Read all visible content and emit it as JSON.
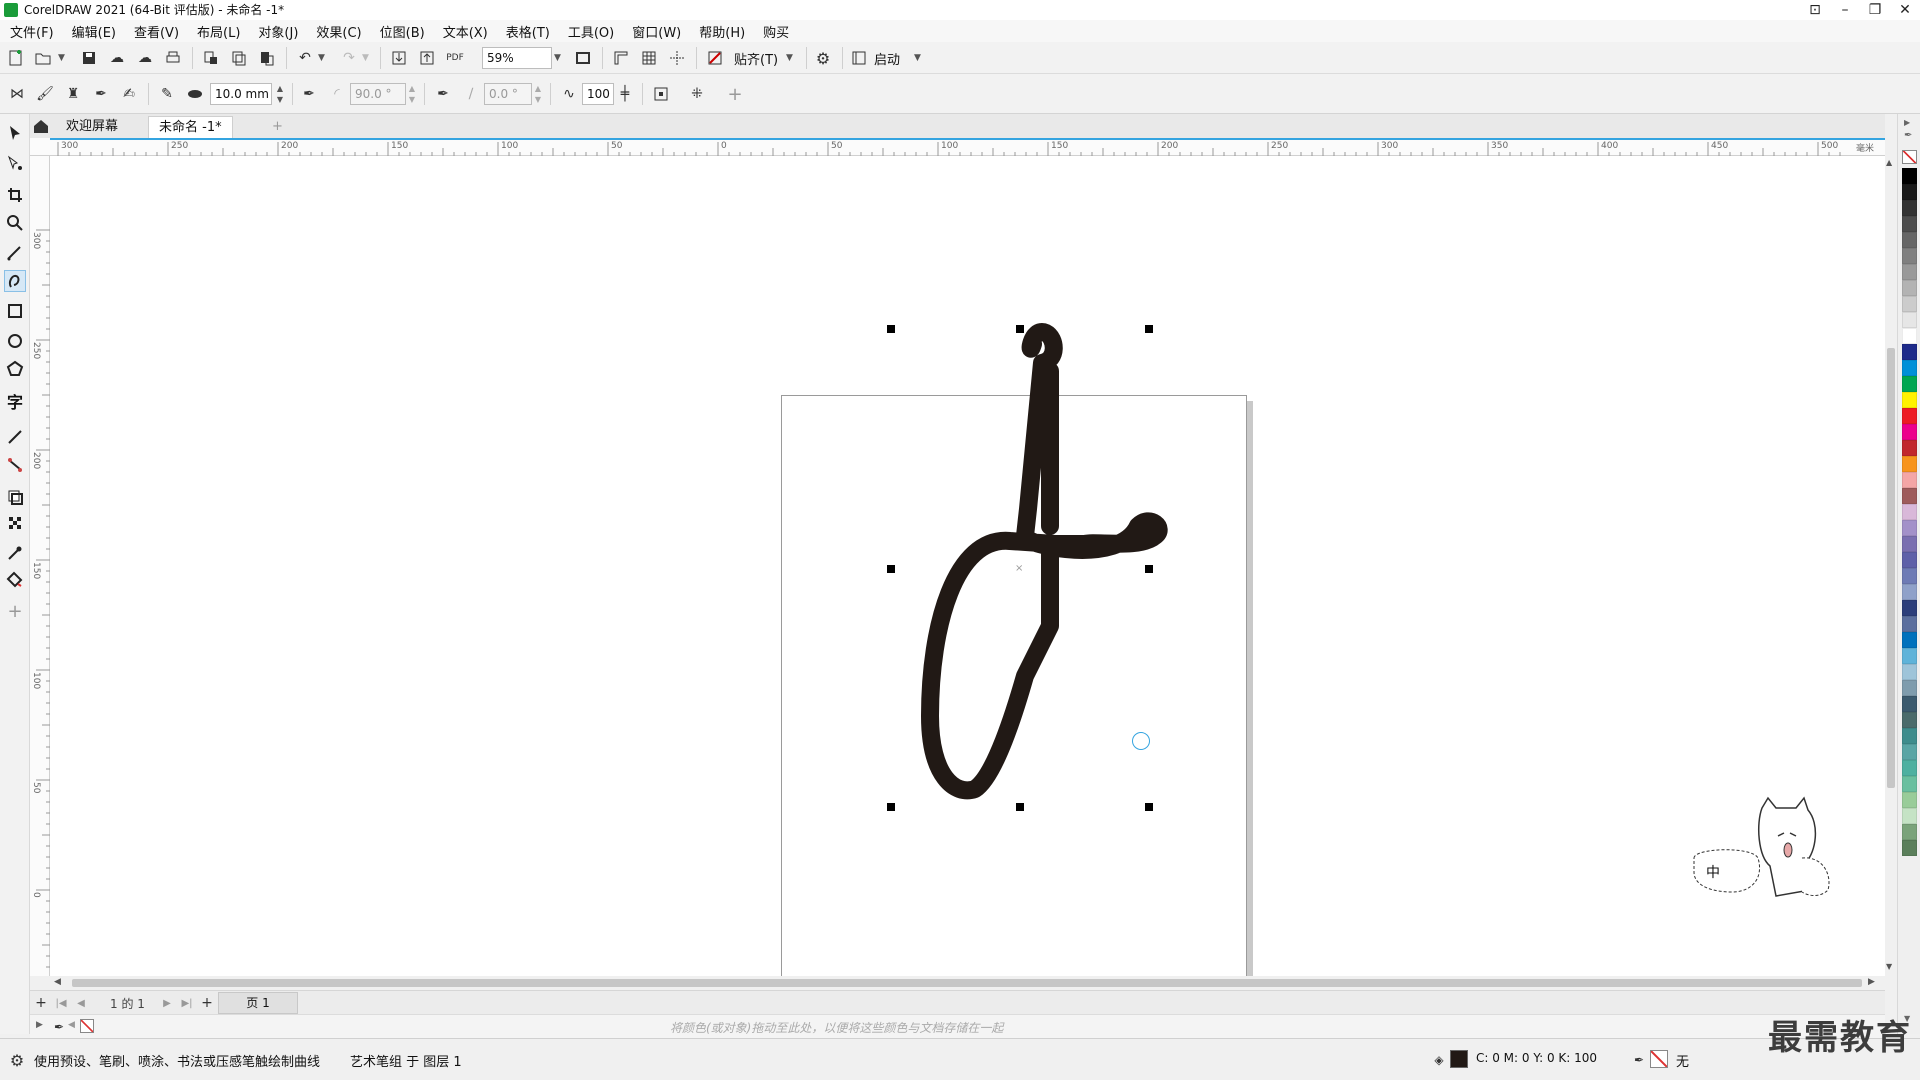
{
  "window": {
    "title": "CorelDRAW 2021 (64-Bit 评估版) - 未命名 -1*",
    "controls": [
      "minimize",
      "restore",
      "close"
    ]
  },
  "menu": [
    "文件(F)",
    "编辑(E)",
    "查看(V)",
    "布局(L)",
    "对象(J)",
    "效果(C)",
    "位图(B)",
    "文本(X)",
    "表格(T)",
    "工具(O)",
    "窗口(W)",
    "帮助(H)",
    "购买"
  ],
  "standard_toolbar": {
    "zoom_value": "59%",
    "snap_label": "贴齐(T)",
    "launch_label": "启动"
  },
  "property_bar": {
    "stroke_width": "10.0 mm",
    "angle1": "90.0 °",
    "angle2": "0.0 °",
    "smoothing": "100"
  },
  "doc_tabs": {
    "welcome": "欢迎屏幕",
    "active": "未命名 -1*",
    "add": "+"
  },
  "ruler": {
    "units": "毫米",
    "h_ticks": [
      "300",
      "250",
      "200",
      "150",
      "100",
      "50",
      "0",
      "50",
      "100",
      "150",
      "200",
      "250",
      "300",
      "350",
      "400",
      "450",
      "500"
    ],
    "v_ticks": [
      "300",
      "250",
      "200",
      "150",
      "100",
      "50",
      "0"
    ]
  },
  "page_nav": {
    "page_count": "1 的 1",
    "page_tab": "页 1"
  },
  "color_docker_hint": "将颜色(或对象)拖动至此处，以便将这些颜色与文档存储在一起",
  "status": {
    "tool_hint": "使用预设、笔刷、喷涂、书法或压感笔触绘制曲线",
    "selection": "艺术笔组 于 图层 1",
    "fill_cmyk": "C: 0 M: 0 Y: 0 K: 100",
    "outline": "无"
  },
  "ime_widget": {
    "label": "中"
  },
  "watermark": "最需教育",
  "colors": {
    "accent": "#34a4e0",
    "stroke": "#211915",
    "palette": [
      "#000000",
      "#1a1a1a",
      "#333333",
      "#4d4d4d",
      "#666666",
      "#808080",
      "#999999",
      "#b3b3b3",
      "#cccccc",
      "#e6e6e6",
      "#ffffff",
      "#1e2b8a",
      "#0090d8",
      "#00a651",
      "#fff200",
      "#ed1c24",
      "#ec008c",
      "#c1272d",
      "#f7941d",
      "#f4a6a6",
      "#9e5b5b",
      "#d9b8d9",
      "#a391c9",
      "#7a6fb0",
      "#5e60a8",
      "#6e7bb5",
      "#8fa1c9",
      "#2c3e7a",
      "#5b6f9e",
      "#0071bc",
      "#5fb3d9",
      "#9ec4d9",
      "#7f9cad",
      "#3b5a6e",
      "#4a6b6b",
      "#3e8c8c",
      "#5aa5a5",
      "#4eb0a0",
      "#6abf9f",
      "#99cc99",
      "#c5e3c5",
      "#7aa37a",
      "#5b7f5b"
    ]
  }
}
